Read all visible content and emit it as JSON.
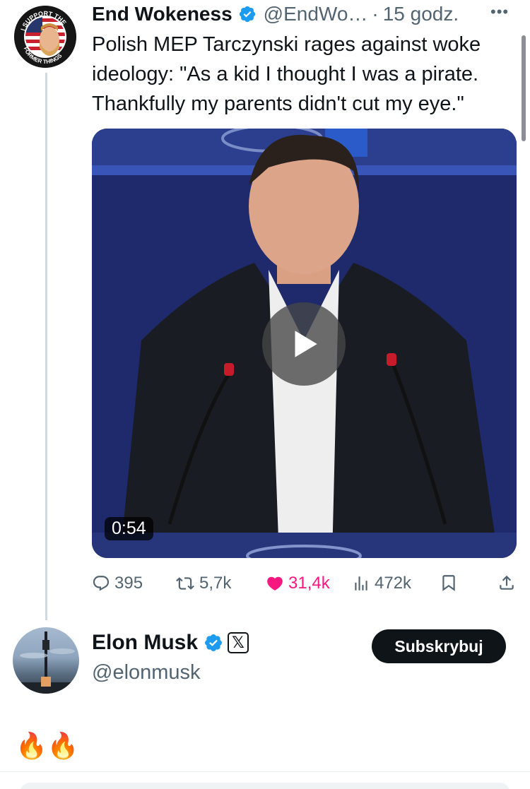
{
  "tweet": {
    "author_name": "End Wokeness",
    "handle": "@EndWo…",
    "dot": "·",
    "time": "15 godz.",
    "more_label": "•••",
    "text": "Polish MEP Tarczynski rages against woke ideology: \"As a kid I thought I was a pirate. Thankfully my parents didn't cut my eye.\"",
    "avatar_text": "I SUPPORT THE FORMER THINGS",
    "video": {
      "duration": "0:54",
      "icon": "play-icon"
    },
    "stats": {
      "replies": "395",
      "retweets": "5,7k",
      "likes": "31,4k",
      "views": "472k"
    },
    "colors": {
      "like_active": "#f91880",
      "verified": "#1d9bf0",
      "muted": "#536471"
    }
  },
  "reply": {
    "author_name": "Elon Musk",
    "handle": "@elonmusk",
    "badge": "𝕏",
    "subscribe_label": "Subskrybuj",
    "text": "🔥🔥"
  }
}
